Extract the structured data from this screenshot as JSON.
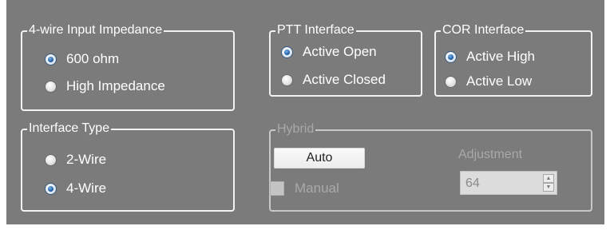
{
  "impedance": {
    "title": "4-wire Input Impedance",
    "options": [
      {
        "label": "600 ohm",
        "selected": true
      },
      {
        "label": "High Impedance",
        "selected": false
      }
    ]
  },
  "ptt": {
    "title": "PTT Interface",
    "options": [
      {
        "label": "Active Open",
        "selected": true
      },
      {
        "label": "Active Closed",
        "selected": false
      }
    ]
  },
  "cor": {
    "title": "COR Interface",
    "options": [
      {
        "label": "Active High",
        "selected": true
      },
      {
        "label": "Active Low",
        "selected": false
      }
    ]
  },
  "interface_type": {
    "title": "Interface Type",
    "options": [
      {
        "label": "2-Wire",
        "selected": false
      },
      {
        "label": "4-Wire",
        "selected": true
      }
    ]
  },
  "hybrid": {
    "title": "Hybrid",
    "enabled": false,
    "auto_label": "Auto",
    "manual_label": "Manual",
    "manual_checked": false,
    "adjustment_label": "Adjustment",
    "adjustment_value": "64"
  },
  "colors": {
    "panel_bg": "#7b7b7b",
    "border": "#f2f2f2",
    "text": "#ffffff",
    "disabled_text": "#a9a9a9",
    "radio_selected": "#1e5fa8"
  }
}
